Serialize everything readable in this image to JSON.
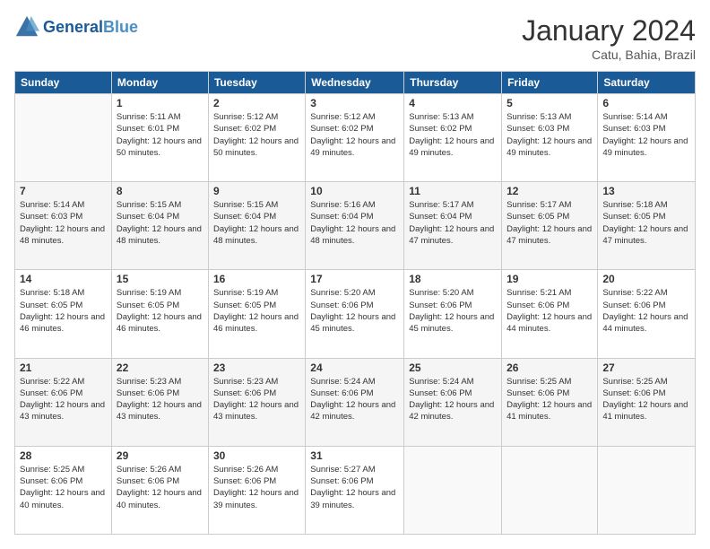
{
  "header": {
    "logo_general": "General",
    "logo_blue": "Blue",
    "month_title": "January 2024",
    "subtitle": "Catu, Bahia, Brazil"
  },
  "weekdays": [
    "Sunday",
    "Monday",
    "Tuesday",
    "Wednesday",
    "Thursday",
    "Friday",
    "Saturday"
  ],
  "weeks": [
    [
      {
        "day": "",
        "sunrise": "",
        "sunset": "",
        "daylight": ""
      },
      {
        "day": "1",
        "sunrise": "Sunrise: 5:11 AM",
        "sunset": "Sunset: 6:01 PM",
        "daylight": "Daylight: 12 hours and 50 minutes."
      },
      {
        "day": "2",
        "sunrise": "Sunrise: 5:12 AM",
        "sunset": "Sunset: 6:02 PM",
        "daylight": "Daylight: 12 hours and 50 minutes."
      },
      {
        "day": "3",
        "sunrise": "Sunrise: 5:12 AM",
        "sunset": "Sunset: 6:02 PM",
        "daylight": "Daylight: 12 hours and 49 minutes."
      },
      {
        "day": "4",
        "sunrise": "Sunrise: 5:13 AM",
        "sunset": "Sunset: 6:02 PM",
        "daylight": "Daylight: 12 hours and 49 minutes."
      },
      {
        "day": "5",
        "sunrise": "Sunrise: 5:13 AM",
        "sunset": "Sunset: 6:03 PM",
        "daylight": "Daylight: 12 hours and 49 minutes."
      },
      {
        "day": "6",
        "sunrise": "Sunrise: 5:14 AM",
        "sunset": "Sunset: 6:03 PM",
        "daylight": "Daylight: 12 hours and 49 minutes."
      }
    ],
    [
      {
        "day": "7",
        "sunrise": "Sunrise: 5:14 AM",
        "sunset": "Sunset: 6:03 PM",
        "daylight": "Daylight: 12 hours and 48 minutes."
      },
      {
        "day": "8",
        "sunrise": "Sunrise: 5:15 AM",
        "sunset": "Sunset: 6:04 PM",
        "daylight": "Daylight: 12 hours and 48 minutes."
      },
      {
        "day": "9",
        "sunrise": "Sunrise: 5:15 AM",
        "sunset": "Sunset: 6:04 PM",
        "daylight": "Daylight: 12 hours and 48 minutes."
      },
      {
        "day": "10",
        "sunrise": "Sunrise: 5:16 AM",
        "sunset": "Sunset: 6:04 PM",
        "daylight": "Daylight: 12 hours and 48 minutes."
      },
      {
        "day": "11",
        "sunrise": "Sunrise: 5:17 AM",
        "sunset": "Sunset: 6:04 PM",
        "daylight": "Daylight: 12 hours and 47 minutes."
      },
      {
        "day": "12",
        "sunrise": "Sunrise: 5:17 AM",
        "sunset": "Sunset: 6:05 PM",
        "daylight": "Daylight: 12 hours and 47 minutes."
      },
      {
        "day": "13",
        "sunrise": "Sunrise: 5:18 AM",
        "sunset": "Sunset: 6:05 PM",
        "daylight": "Daylight: 12 hours and 47 minutes."
      }
    ],
    [
      {
        "day": "14",
        "sunrise": "Sunrise: 5:18 AM",
        "sunset": "Sunset: 6:05 PM",
        "daylight": "Daylight: 12 hours and 46 minutes."
      },
      {
        "day": "15",
        "sunrise": "Sunrise: 5:19 AM",
        "sunset": "Sunset: 6:05 PM",
        "daylight": "Daylight: 12 hours and 46 minutes."
      },
      {
        "day": "16",
        "sunrise": "Sunrise: 5:19 AM",
        "sunset": "Sunset: 6:05 PM",
        "daylight": "Daylight: 12 hours and 46 minutes."
      },
      {
        "day": "17",
        "sunrise": "Sunrise: 5:20 AM",
        "sunset": "Sunset: 6:06 PM",
        "daylight": "Daylight: 12 hours and 45 minutes."
      },
      {
        "day": "18",
        "sunrise": "Sunrise: 5:20 AM",
        "sunset": "Sunset: 6:06 PM",
        "daylight": "Daylight: 12 hours and 45 minutes."
      },
      {
        "day": "19",
        "sunrise": "Sunrise: 5:21 AM",
        "sunset": "Sunset: 6:06 PM",
        "daylight": "Daylight: 12 hours and 44 minutes."
      },
      {
        "day": "20",
        "sunrise": "Sunrise: 5:22 AM",
        "sunset": "Sunset: 6:06 PM",
        "daylight": "Daylight: 12 hours and 44 minutes."
      }
    ],
    [
      {
        "day": "21",
        "sunrise": "Sunrise: 5:22 AM",
        "sunset": "Sunset: 6:06 PM",
        "daylight": "Daylight: 12 hours and 43 minutes."
      },
      {
        "day": "22",
        "sunrise": "Sunrise: 5:23 AM",
        "sunset": "Sunset: 6:06 PM",
        "daylight": "Daylight: 12 hours and 43 minutes."
      },
      {
        "day": "23",
        "sunrise": "Sunrise: 5:23 AM",
        "sunset": "Sunset: 6:06 PM",
        "daylight": "Daylight: 12 hours and 43 minutes."
      },
      {
        "day": "24",
        "sunrise": "Sunrise: 5:24 AM",
        "sunset": "Sunset: 6:06 PM",
        "daylight": "Daylight: 12 hours and 42 minutes."
      },
      {
        "day": "25",
        "sunrise": "Sunrise: 5:24 AM",
        "sunset": "Sunset: 6:06 PM",
        "daylight": "Daylight: 12 hours and 42 minutes."
      },
      {
        "day": "26",
        "sunrise": "Sunrise: 5:25 AM",
        "sunset": "Sunset: 6:06 PM",
        "daylight": "Daylight: 12 hours and 41 minutes."
      },
      {
        "day": "27",
        "sunrise": "Sunrise: 5:25 AM",
        "sunset": "Sunset: 6:06 PM",
        "daylight": "Daylight: 12 hours and 41 minutes."
      }
    ],
    [
      {
        "day": "28",
        "sunrise": "Sunrise: 5:25 AM",
        "sunset": "Sunset: 6:06 PM",
        "daylight": "Daylight: 12 hours and 40 minutes."
      },
      {
        "day": "29",
        "sunrise": "Sunrise: 5:26 AM",
        "sunset": "Sunset: 6:06 PM",
        "daylight": "Daylight: 12 hours and 40 minutes."
      },
      {
        "day": "30",
        "sunrise": "Sunrise: 5:26 AM",
        "sunset": "Sunset: 6:06 PM",
        "daylight": "Daylight: 12 hours and 39 minutes."
      },
      {
        "day": "31",
        "sunrise": "Sunrise: 5:27 AM",
        "sunset": "Sunset: 6:06 PM",
        "daylight": "Daylight: 12 hours and 39 minutes."
      },
      {
        "day": "",
        "sunrise": "",
        "sunset": "",
        "daylight": ""
      },
      {
        "day": "",
        "sunrise": "",
        "sunset": "",
        "daylight": ""
      },
      {
        "day": "",
        "sunrise": "",
        "sunset": "",
        "daylight": ""
      }
    ]
  ]
}
